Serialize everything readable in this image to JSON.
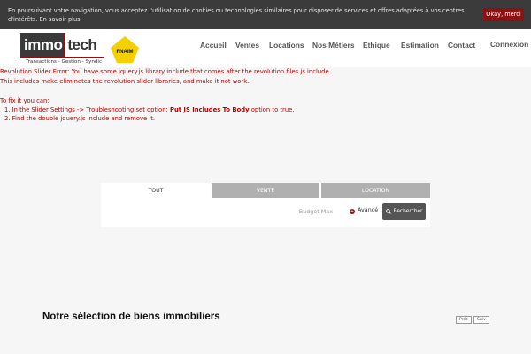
{
  "cookie": {
    "text": "En poursuivant votre navigation, vous acceptez l'utilisation de cookies ou technologies similaires pour disposer de services et offres adaptées à vos centres d'intérêts. En savoir plus.",
    "button": "Okay, merci"
  },
  "logo": {
    "part1": "immo",
    "part2": "tech",
    "tagline": "Transactions - Gestion - Syndic",
    "badge_text": "FNAIM"
  },
  "nav": {
    "items": [
      "Accueil",
      "Ventes",
      "Locations",
      "Nos Métiers",
      "Ethique",
      "Estimation",
      "Contact"
    ],
    "login": "Connexion"
  },
  "error": {
    "line1": "Revolution Slider Error: You have some jquery.js library include that comes after the revolution files js include.",
    "line2": "This includes make eliminates the revolution slider libraries, and make it not work.",
    "fix_intro": "To fix it you can:",
    "step1_prefix": "1. In the Slider Settings -> Troubleshooting set option:",
    "step1_bold": "Put JS Includes To Body",
    "step1_suffix": "option to true.",
    "step2": "2. Find the double jquery.js include and remove it."
  },
  "search": {
    "tabs": [
      "TOUT",
      "VENTE",
      "LOCATION"
    ],
    "budget_placeholder": "Budget Max",
    "advanced": "Avancé",
    "button": "Rechercher"
  },
  "selection": {
    "title": "Notre sélection de biens immobiliers",
    "prev": "Préc",
    "next": "Suiv"
  },
  "colors": {
    "accent": "#8a1212",
    "cookie_bg": "#3b3b3b",
    "error_text": "#b30000",
    "tab_inactive": "#b0b0b0",
    "button_dark": "#555555"
  }
}
